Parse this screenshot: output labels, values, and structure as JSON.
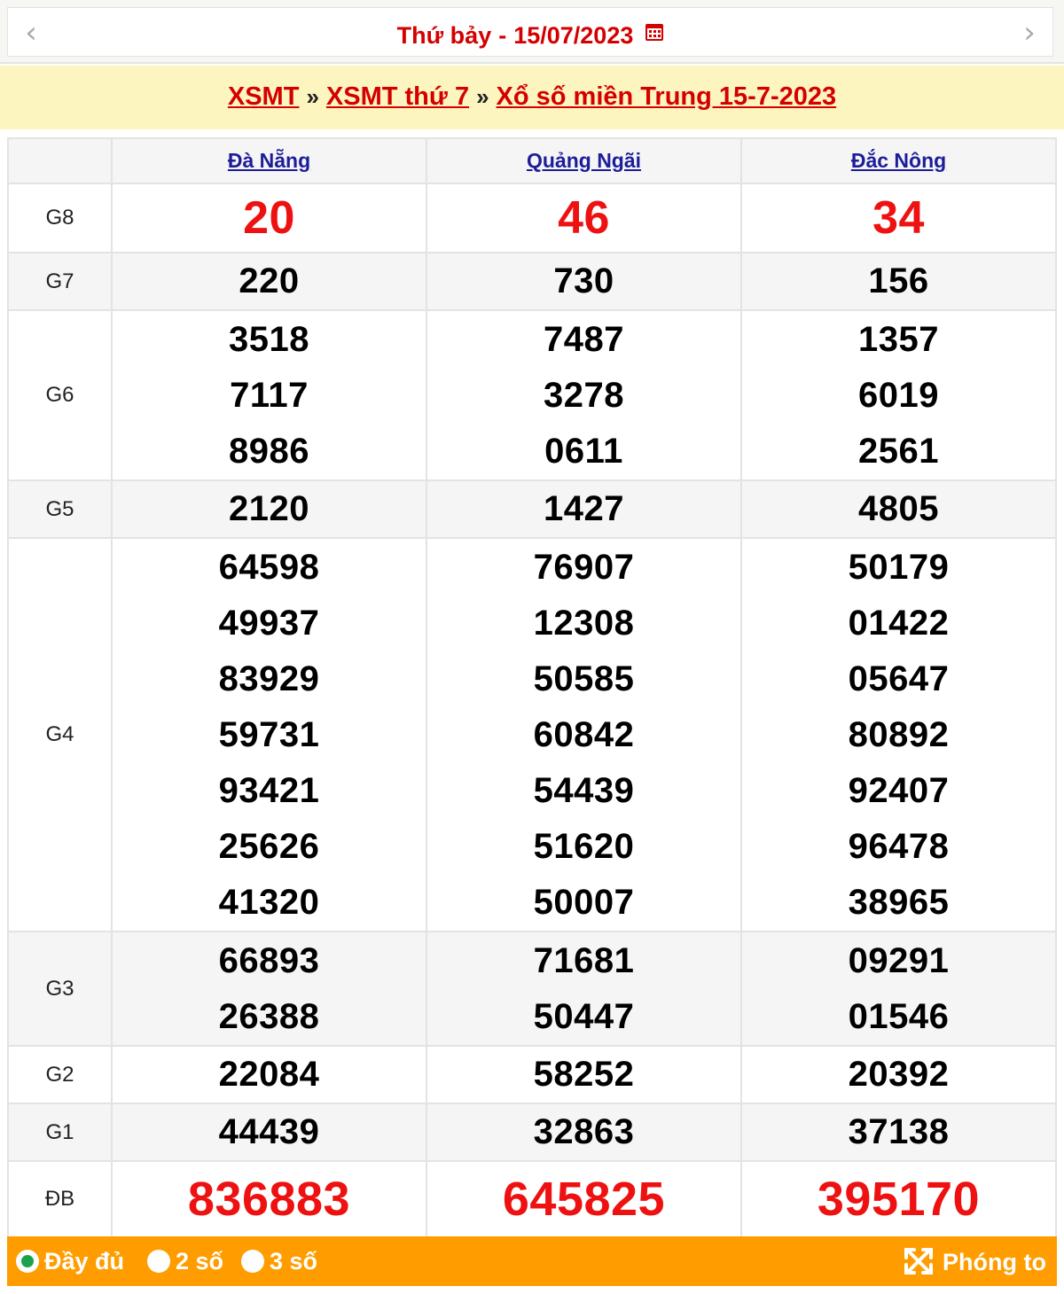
{
  "date_nav": {
    "weekday": "Thứ bảy",
    "separator": "-",
    "date": "15/07/2023",
    "prev_icon": "chevron-left-icon",
    "next_icon": "chevron-right-icon",
    "calendar_icon": "calendar-icon"
  },
  "breadcrumb": {
    "items": [
      "XSMT",
      "XSMT thứ 7",
      "Xổ số miền Trung 15-7-2023"
    ],
    "separator": "»"
  },
  "table": {
    "provinces": [
      "Đà Nẵng",
      "Quảng Ngãi",
      "Đắc Nông"
    ],
    "prizes": [
      {
        "label": "G8",
        "values": [
          [
            "20"
          ],
          [
            "46"
          ],
          [
            "34"
          ]
        ]
      },
      {
        "label": "G7",
        "values": [
          [
            "220"
          ],
          [
            "730"
          ],
          [
            "156"
          ]
        ]
      },
      {
        "label": "G6",
        "values": [
          [
            "3518",
            "7117",
            "8986"
          ],
          [
            "7487",
            "3278",
            "0611"
          ],
          [
            "1357",
            "6019",
            "2561"
          ]
        ]
      },
      {
        "label": "G5",
        "values": [
          [
            "2120"
          ],
          [
            "1427"
          ],
          [
            "4805"
          ]
        ]
      },
      {
        "label": "G4",
        "values": [
          [
            "64598",
            "49937",
            "83929",
            "59731",
            "93421",
            "25626",
            "41320"
          ],
          [
            "76907",
            "12308",
            "50585",
            "60842",
            "54439",
            "51620",
            "50007"
          ],
          [
            "50179",
            "01422",
            "05647",
            "80892",
            "92407",
            "96478",
            "38965"
          ]
        ]
      },
      {
        "label": "G3",
        "values": [
          [
            "66893",
            "26388"
          ],
          [
            "71681",
            "50447"
          ],
          [
            "09291",
            "01546"
          ]
        ]
      },
      {
        "label": "G2",
        "values": [
          [
            "22084"
          ],
          [
            "58252"
          ],
          [
            "20392"
          ]
        ]
      },
      {
        "label": "G1",
        "values": [
          [
            "44439"
          ],
          [
            "32863"
          ],
          [
            "37138"
          ]
        ]
      },
      {
        "label": "ĐB",
        "values": [
          [
            "836883"
          ],
          [
            "645825"
          ],
          [
            "395170"
          ]
        ]
      }
    ]
  },
  "options": {
    "full_label": "Đầy đủ",
    "two_label": "2 số",
    "three_label": "3 số",
    "zoom_label": "Phóng to",
    "selected": "full",
    "zoom_icon": "expand-icon"
  },
  "colors": {
    "red": "#d40000",
    "prize_red": "#ee1111",
    "link_blue": "#1d1d9a",
    "breadcrumb_bg": "#fdf5c0",
    "option_bar_bg": "#ff9d00",
    "radio_selected": "#1aa34a"
  }
}
